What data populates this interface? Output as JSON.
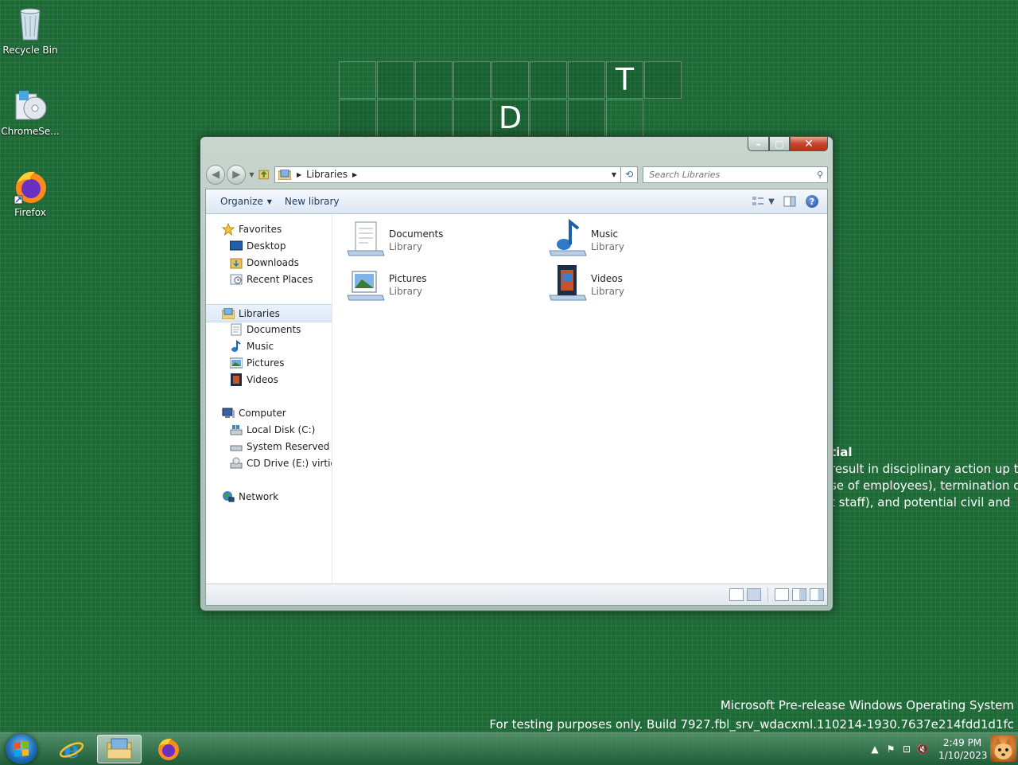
{
  "desktop": {
    "board_letters": [
      "T",
      "D"
    ],
    "notice_lines": [
      "tial",
      "result in disciplinary action up to",
      "se of employees), termination of",
      "t staff), and potential civil and"
    ],
    "watermark_line1": "Microsoft Pre-release Windows Operating System",
    "watermark_line2": "For testing purposes only. Build 7927.fbl_srv_wdacxml.110214-1930.7637e214fdd1d1fc",
    "icons": [
      {
        "label": "Recycle Bin",
        "icon": "recycle-bin-icon"
      },
      {
        "label": "ChromeSe...",
        "icon": "chrome-setup-icon"
      },
      {
        "label": "Firefox",
        "icon": "firefox-icon"
      }
    ]
  },
  "window": {
    "controls": {
      "minimize": "–",
      "maximize": "▢",
      "close": "✕"
    },
    "address": {
      "crumb": "Libraries"
    },
    "search": {
      "placeholder": "Search Libraries"
    },
    "toolbar": {
      "organize": "Organize",
      "new_library": "New library"
    },
    "nav": {
      "favorites": "Favorites",
      "desktop": "Desktop",
      "downloads": "Downloads",
      "recent": "Recent Places",
      "libraries": "Libraries",
      "lib_documents": "Documents",
      "lib_music": "Music",
      "lib_pictures": "Pictures",
      "lib_videos": "Videos",
      "computer": "Computer",
      "local_disk": "Local Disk (C:)",
      "system_reserved": "System Reserved (D:",
      "cd_drive": "CD Drive (E:) virtio-v",
      "network": "Network"
    },
    "items": [
      {
        "name": "Documents",
        "type": "Library"
      },
      {
        "name": "Music",
        "type": "Library"
      },
      {
        "name": "Pictures",
        "type": "Library"
      },
      {
        "name": "Videos",
        "type": "Library"
      }
    ]
  },
  "taskbar": {
    "time": "2:49 PM",
    "date": "1/10/2023"
  },
  "colors": {
    "desktop": "#1d6a37",
    "accent": "#1e395b"
  }
}
